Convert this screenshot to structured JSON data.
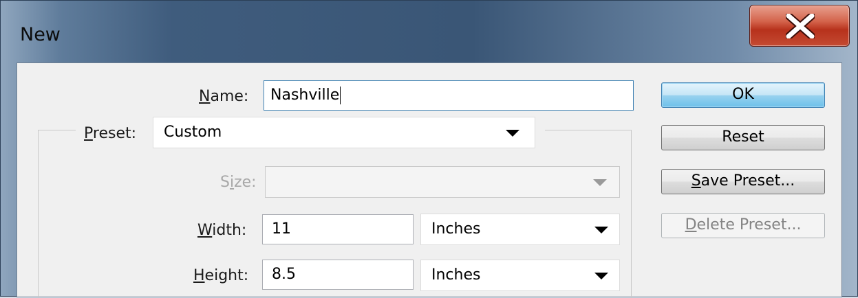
{
  "dialog": {
    "title": "New",
    "close_symbol": "X"
  },
  "form": {
    "name": {
      "label_first": "N",
      "label_rest": "ame:",
      "value": "Nashville"
    },
    "preset": {
      "label_first": "P",
      "label_rest": "reset:",
      "value": "Custom"
    },
    "size": {
      "label_pre": "S",
      "label_u": "i",
      "label_post": "ze:",
      "value": ""
    },
    "width": {
      "label_first": "W",
      "label_rest": "idth:",
      "value": "11",
      "unit": "Inches"
    },
    "height": {
      "label_first": "H",
      "label_rest": "eight:",
      "value": "8.5",
      "unit": "Inches"
    }
  },
  "buttons": {
    "ok": "OK",
    "reset": "Reset",
    "save_preset_first": "S",
    "save_preset_rest": "ave Preset...",
    "delete_preset_first": "D",
    "delete_preset_rest": "elete Preset..."
  },
  "icons": {
    "close": "close-icon",
    "dropdown": "chevron-down-icon"
  },
  "colors": {
    "close_button": "#c44a32",
    "default_button_border": "#3c7fb1",
    "window_frame": "#3f5c7d"
  }
}
